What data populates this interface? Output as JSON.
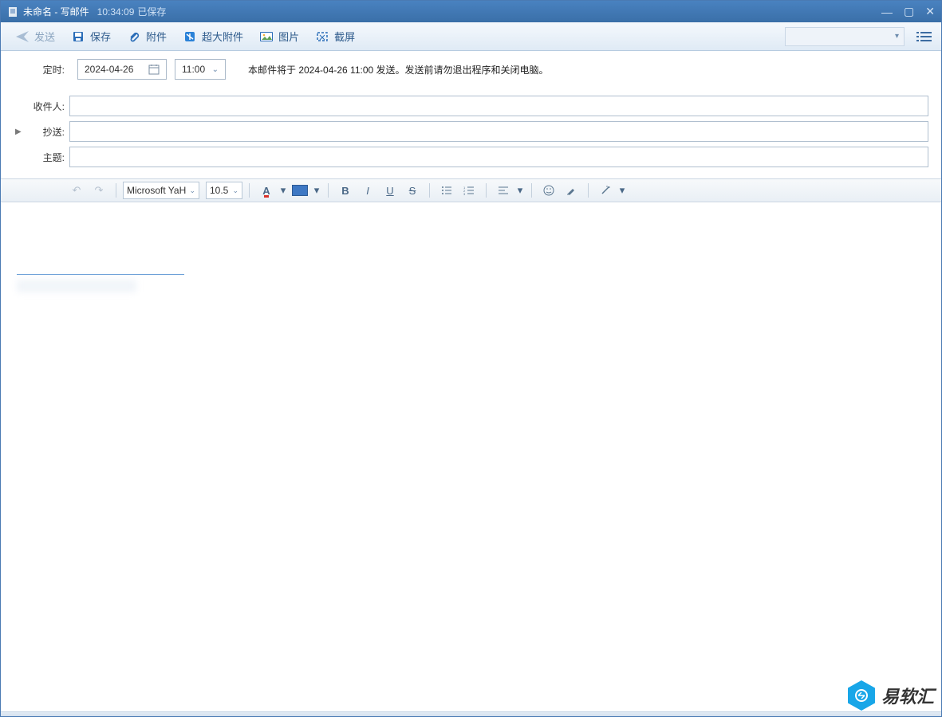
{
  "titlebar": {
    "title": "未命名 - 写邮件",
    "timestamp": "10:34:09",
    "saved": "已保存"
  },
  "toolbar": {
    "send": "发送",
    "save": "保存",
    "attach": "附件",
    "bigattach": "超大附件",
    "image": "图片",
    "screenshot": "截屏"
  },
  "schedule": {
    "label": "定时:",
    "date": "2024-04-26",
    "time": "11:00",
    "message": "本邮件将于 2024-04-26 11:00 发送。发送前请勿退出程序和关闭电脑。"
  },
  "fields": {
    "to_label": "收件人:",
    "cc_label": "抄送:",
    "subject_label": "主题:",
    "to": "",
    "cc": "",
    "subject": ""
  },
  "editor": {
    "font": "Microsoft YaH",
    "size": "10.5"
  },
  "watermark": "易软汇"
}
